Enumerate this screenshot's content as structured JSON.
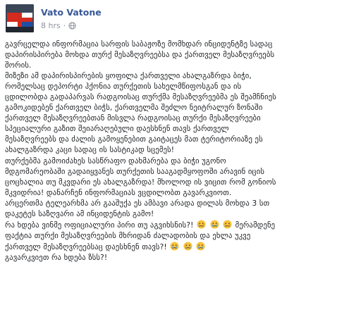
{
  "post": {
    "author": "Vato Vatone",
    "time": "8 hrs",
    "separator": "·",
    "privacy_icon": "globe-icon",
    "avatar_icon": "profile-avatar-flag",
    "emoji_icon": "crying-face-emoji",
    "lines": [
      "გავრცელდა ინფორმაცია სარფის საბაჟოზე მომხდარ ინციდენტზე სადაც",
      "დაპირისპირება მოხდა თურქ მესაზღვრეებსა და ქართველ მესაზღვრეებს",
      "შორის.",
      "მიზეზი ამ დაპირისპირების ყოფილა ქართველი ახალგაზრდა ბიჭი,",
      "რომელსაც დეპორტი ჰქონია თურქეთის სახელმწიფოსგან და ის",
      "ცდილობდა გადაპარვას რადგოისაც თურქმა მესაზღვრეებმა ეს შეამჩნიეს",
      "გამოკიდებენ ქართველ ბიჭს, ქართველმა შეძლო ნეიტრალურ ზონაში",
      "ქართველ მესაზღვრეებთან მისვლა რადგოისაც თურქი მესაზღვრეები",
      "სპეციალური გაზით შეიარაღებული დაესხნენ თავს ქართველ",
      "მესაზღვრეებს და ძალის გამოყენებით გაიტაცეს მათ ტერიტორიაზე ეს",
      "ახალგაზრდა კაცი სადაც ის სასტიკად სცემეს!",
      "თურქებმა გამოიძახეს სასწრაფო დახმარება და ბიჭი უგონო",
      "მდგომარეობაში გადაიყვანეს თურქეთის სააგადმყოფოში არავინ იცის",
      "ცოცხალია თუ მკვდარი ეს ახალგაზრდა! მხოლოდ ის ვიცით რომ გონიოს",
      "მკვიდრია! დანარჩენ ინფორმაციას ვცდილობთ გავარკვიოთ.",
      "არცერთმა ტელეარხმა არ გააშუქა ეს ამბავი არადა დილას მოხდა 3 სთ",
      "დაკეტეს საზღვარი ამ ინციდენტის გამო!",
      "რა ხდება ვინმე ოფიციალური პირი თუ აგვიხსნის?!",
      "მერამდენე",
      "ფაქტია თურქი მესაზღვრეების მხრიდან ძალადობის და ეხლა უკვე",
      "ქართველ მესაზღვრეებსაც დაესხნენ თავს?!",
      "გავარკვიეთ რა ხდება ზსს?!"
    ]
  }
}
